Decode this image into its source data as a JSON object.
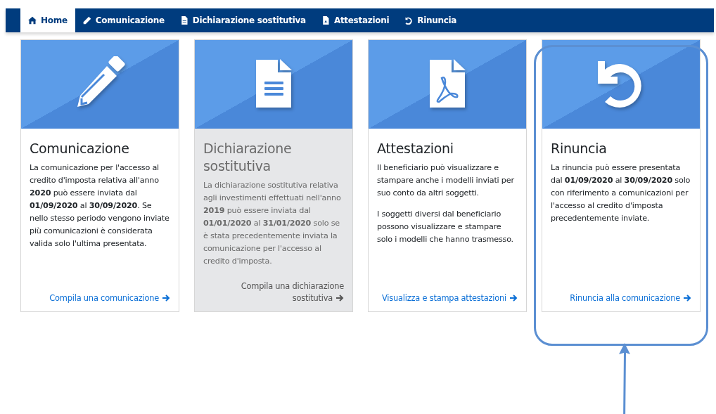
{
  "nav": [
    {
      "label": "Home",
      "selected": true
    },
    {
      "label": "Comunicazione",
      "selected": false
    },
    {
      "label": "Dichiarazione sostitutiva",
      "selected": false
    },
    {
      "label": "Attestazioni",
      "selected": false
    },
    {
      "label": "Rinuncia",
      "selected": false
    }
  ],
  "cards": [
    {
      "title": "Comunicazione",
      "disabled": false,
      "highlighted": false,
      "paragraphs": [
        "La comunicazione per l'accesso al credito d'imposta relativa all'anno **2020** può essere inviata dal **01/09/2020** al **30/09/2020**. Se nello stesso periodo vengono inviate più comunicazioni è considerata valida solo l'ultima presentata."
      ],
      "link": "Compila una comunicazione"
    },
    {
      "title": "Dichiarazione sostitutiva",
      "disabled": true,
      "highlighted": false,
      "paragraphs": [
        "La dichiarazione sostitutiva relativa agli investimenti effettuati nell'anno **2019** può essere inviata dal **01/01/2020** al **31/01/2020** solo se è stata precedentemente inviata la comunicazione per l'accesso al credito d'imposta."
      ],
      "link": "Compila una dichiarazione sostitutiva"
    },
    {
      "title": "Attestazioni",
      "disabled": false,
      "highlighted": false,
      "paragraphs": [
        "Il beneficiario può visualizzare e stampare anche i modelli inviati per suo conto da altri soggetti.",
        "I soggetti diversi dal beneficiario possono visualizzare e stampare solo i modelli che hanno trasmesso."
      ],
      "link": "Visualizza e stampa attestazioni"
    },
    {
      "title": "Rinuncia",
      "disabled": false,
      "highlighted": true,
      "paragraphs": [
        "La rinuncia può essere presentata dal **01/09/2020** al **30/09/2020** solo con riferimento a comunicazioni per l'accesso al credito d'imposta precedentemente inviate."
      ],
      "link": "Rinuncia alla comunicazione"
    }
  ]
}
